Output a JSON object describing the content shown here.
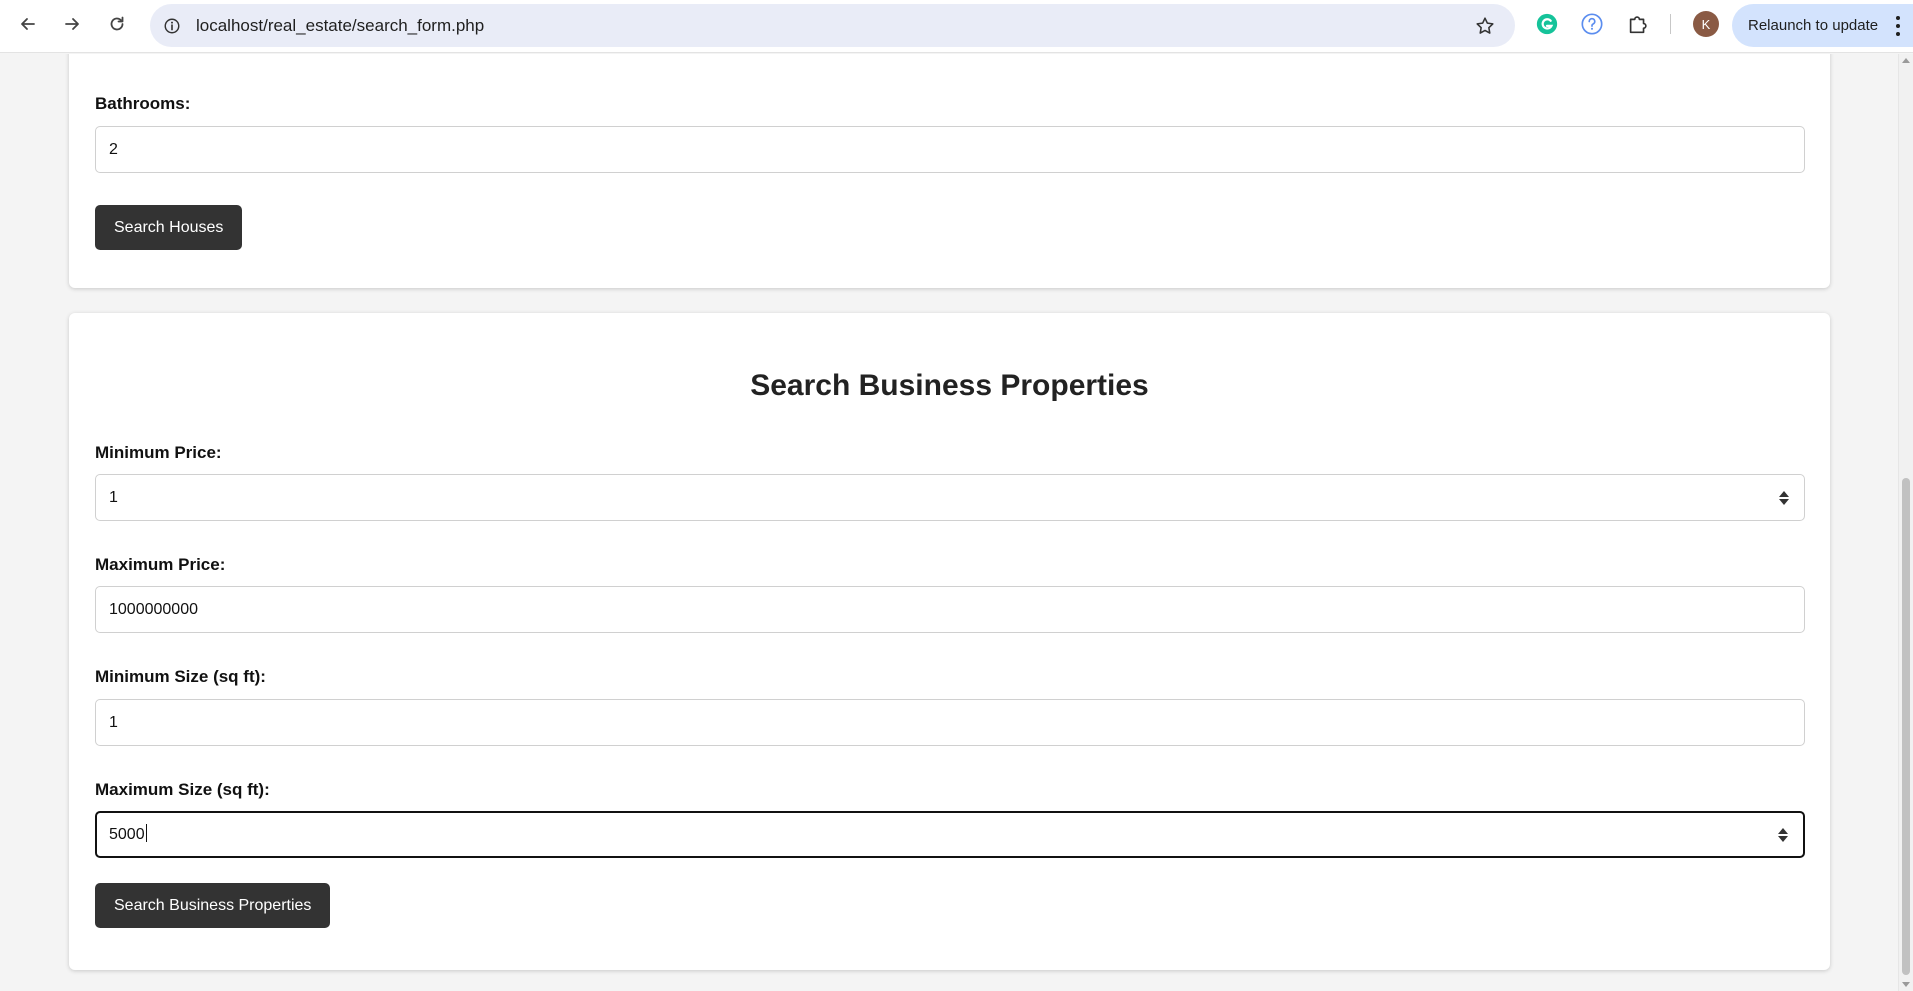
{
  "browser": {
    "url": "localhost/real_estate/search_form.php",
    "avatar_initial": "K",
    "relaunch_label": "Relaunch to update"
  },
  "house_search": {
    "bathrooms_label": "Bathrooms:",
    "bathrooms_value": "2",
    "submit_label": "Search Houses"
  },
  "business_search": {
    "title": "Search Business Properties",
    "min_price_label": "Minimum Price:",
    "min_price_value": "1",
    "max_price_label": "Maximum Price:",
    "max_price_value": "1000000000",
    "min_size_label": "Minimum Size (sq ft):",
    "min_size_value": "1",
    "max_size_label": "Maximum Size (sq ft):",
    "max_size_value": "5000",
    "submit_label": "Search Business Properties"
  },
  "colors": {
    "button_bg": "#333333",
    "page_bg": "#f4f4f4",
    "omnibox_bg": "#e9ecf7",
    "relaunch_bg": "#d3e3fd",
    "grammarly": "#15c39a",
    "help_icon": "#5b8def"
  },
  "icons": [
    "back-arrow-icon",
    "forward-arrow-icon",
    "reload-icon",
    "site-info-icon",
    "bookmark-star-icon",
    "grammarly-icon",
    "help-circle-icon",
    "extensions-puzzle-icon",
    "kebab-menu-icon"
  ]
}
